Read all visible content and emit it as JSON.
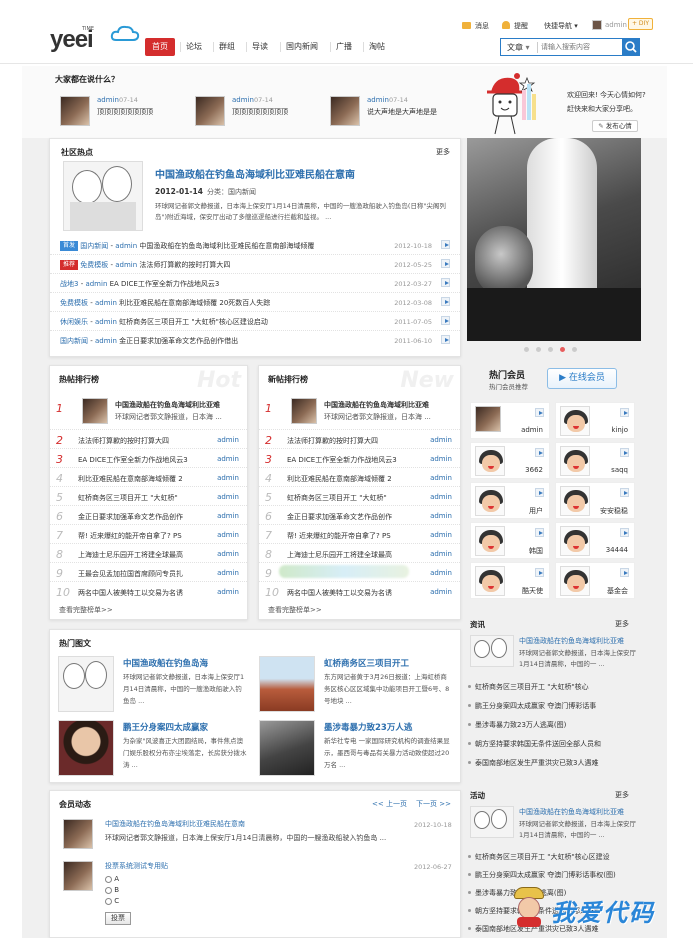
{
  "header": {
    "logo": "yeei",
    "logo_sub": "TIME",
    "tabs": [
      "首页",
      "论坛",
      "群组",
      "导读",
      "国内新闻",
      "广播",
      "淘帖"
    ],
    "active_tab": 0,
    "toplinks": {
      "messages": "消息",
      "reminders": "提醒",
      "quicknav": "快捷导航",
      "user": "admin",
      "diy": "+ DIY"
    },
    "search": {
      "type": "文章",
      "placeholder": "请输入搜索内容"
    }
  },
  "talk": {
    "title": "大家都在说什么？",
    "items": [
      {
        "user": "admin",
        "date": "07-14",
        "text": "顶顶顶顶顶顶顶顶"
      },
      {
        "user": "admin",
        "date": "07-14",
        "text": "顶顶顶顶顶顶顶顶"
      },
      {
        "user": "admin",
        "date": "07-14",
        "text": "说大声地是大声地是是"
      }
    ],
    "welcome_1": "欢迎回来! 今天心情如何?",
    "welcome_2": "赶快来和大家分享吧。",
    "post_mood": "发布心情"
  },
  "hot": {
    "title": "社区热点",
    "more": "更多",
    "headline": "中国渔政船在钓鱼岛海域利比亚难民船在意南",
    "date": "2012-01-14",
    "category": "分类：国内新闻",
    "summary": "环球网记者郭文静报道，日本海上保安厅1月14日清晨称，中国的一艘渔政船驶入钓鱼岛(日称\"尖阁列岛\")附近海域，保安厅出动了多艘巡逻船进行拦截和监视。 ...",
    "list": [
      {
        "tag": "首发",
        "cat": "国内新闻",
        "author": "admin",
        "title": "中国渔政船在钓鱼岛海域利比亚难民船在意南部海域倾覆",
        "date": "2012-10-18"
      },
      {
        "tag": "推荐",
        "cat": "免费模板",
        "author": "admin",
        "title": "法法师打算歉的按时打算大四",
        "date": "2012-05-25"
      },
      {
        "tag": "",
        "cat": "战地3",
        "author": "admin",
        "title": "EA DICE工作室全新力作战地风云3",
        "date": "2012-03-27"
      },
      {
        "tag": "",
        "cat": "免费模板",
        "author": "admin",
        "title": "利比亚难民船在意南部海域倾覆 20死数百人失踪",
        "date": "2012-03-08"
      },
      {
        "tag": "",
        "cat": "休闲娱乐",
        "author": "admin",
        "title": "虹桥商务区三项目开工 \"大虹桥\"核心区建设启动",
        "date": "2011-07-05"
      },
      {
        "tag": "",
        "cat": "国内新闻",
        "author": "admin",
        "title": "金正日要求加强革命文艺作品创作借出",
        "date": "2011-06-10"
      }
    ]
  },
  "rank_hot": {
    "title": "热帖排行榜",
    "bg": "Hot",
    "top_title": "中国渔政船在钓鱼岛海域利比亚难",
    "top_text": "环球网记者郭文静报道，日本海 ...",
    "more": "查看完整榜单>>",
    "items": [
      "法法师打算歉的按时打算大四",
      "EA DICE工作室全新力作战地风云3",
      "利比亚难民船在意南部海域倾覆 2",
      "虹桥商务区三项目开工 \"大虹桥\"",
      "金正日要求加强革命文艺作品创作",
      "帮! 近来爆红的能开帝自拿了? PS",
      "上海迪士尼乐园开工将建全球最高",
      "王最会见孟加拉国首席顾问专员扎",
      "两名中国人被美特工以交易为名诱"
    ],
    "author": "admin"
  },
  "rank_new": {
    "title": "新帖排行榜",
    "bg": "New",
    "top_title": "中国渔政船在钓鱼岛海域利比亚难",
    "top_text": "环球网记者郭文静报道，日本海 ...",
    "more": "查看完整榜单>>",
    "items": [
      "法法师打算歉的按时打算大四",
      "EA DICE工作室全新力作战地风云3",
      "利比亚难民船在意南部海域倾覆 2",
      "虹桥商务区三项目开工 \"大虹桥\"",
      "金正日要求加强革命文艺作品创作",
      "帮! 近来爆红的能开帝自拿了? PS",
      "上海迪士尼乐园开工将建全球最高",
      "",
      "两名中国人被美特工以交易为名诱"
    ],
    "author": "admin"
  },
  "hot_members": {
    "title": "热门会员",
    "sub": "热门会员推荐",
    "online_btn": "在线会员",
    "members": [
      "admin",
      "kinjo",
      "3662",
      "saqq",
      "用户",
      "安安稳稳",
      "韩国",
      "34444",
      "酷天使",
      "基金会"
    ]
  },
  "pics": {
    "title": "热门图文",
    "items": [
      {
        "title": "中国渔政船在钓鱼岛海",
        "text": "环球网记者郭文静报道，日本海上保安厅1月14日清晨称，中国的一艘渔政船驶入钓鱼岛 ..."
      },
      {
        "title": "虹桥商务区三项目开工",
        "text": "东方网记者黄于3月26日报道：上海虹桥商务区核心区区域集中功能项目开工暨6号、8号地块 ..."
      },
      {
        "title": "鹏王分身案四太成赢家",
        "text": "为杂家\"风波喜正大团圆结局，事件焦点澳门娱乐股权分布亦尘埃落定，长房获分拨水涛 ..."
      },
      {
        "title": "墨涉毒暴力致23万人逃",
        "text": "新华社专电 一家国际研究机构的调查结果显示，墨西哥与毒品有关暴力活动致使超过20万名 ..."
      }
    ]
  },
  "activity": {
    "title": "会员动态",
    "prev": "<< 上一页",
    "next": "下一页 >>",
    "items": [
      {
        "title": "中国渔政船在钓鱼岛海域利比亚难民船在意南",
        "text": "环球网记者郭文静报道，日本海上保安厅1月14日清晨称，中国的一艘渔政船驶入钓鱼岛 ...",
        "date": "2012-10-18"
      },
      {
        "title": "投票系统测试专用贴",
        "date": "2012-06-27",
        "options": [
          "A",
          "B",
          "C"
        ],
        "vote": "投票"
      }
    ]
  },
  "news": {
    "title": "资讯",
    "more": "更多",
    "feature_title": "中国渔政船在钓鱼岛海域利比亚难",
    "feature_text": "环球网记者郭文静报道，日本海上保安厅1月14日清晨称，中国的一 ...",
    "list": [
      "虹桥商务区三项目开工 \"大虹桥\"核心",
      "鹏王分身案四太成赢家 夺澳门博彩话事",
      "墨涉毒暴力致23万人逃离(图)",
      "朝方坚持要求韩国无条件送回全部人员和",
      "泰国南部地区发生严重洪灾已致3人遇难"
    ]
  },
  "events": {
    "title": "活动",
    "more": "更多",
    "feature_title": "中国渔政船在钓鱼岛海域利比亚难",
    "feature_text": "环球网记者郭文静报道，日本海上保安厅1月14日清晨称，中国的一 ...",
    "list": [
      "虹桥商务区三项目开工 \"大虹桥\"核心区建设",
      "鹏王分身案四太成赢家 夺澳门博彩话事权(图)",
      "墨涉毒暴力致23万人逃离(图)",
      "朝方坚持要求韩国无条件送回全部人员和",
      "泰国南部地区发生严重洪灾已致3人遇难"
    ]
  },
  "watermark": "我爱代码"
}
